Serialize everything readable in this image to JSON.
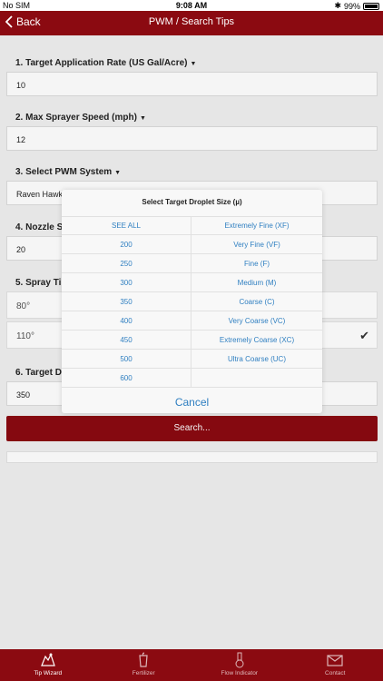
{
  "status_bar": {
    "carrier": "No SIM",
    "time": "9:08 AM",
    "battery": "99%",
    "battery_level": 0.99
  },
  "navbar": {
    "back_label": "Back",
    "title": "PWM / Search Tips"
  },
  "sections": [
    {
      "header": "1. Target Application Rate (US Gal/Acre)",
      "value": "10"
    },
    {
      "header": "2. Max Sprayer Speed (mph)",
      "value": "12"
    },
    {
      "header": "3. Select PWM System",
      "value": "Raven Hawke"
    },
    {
      "header": "4. Nozzle S",
      "value": "20"
    },
    {
      "header": "5. Spray Tip"
    },
    {
      "header": "6. Target Dr",
      "value": "350"
    }
  ],
  "spray_tip_options": [
    {
      "label": "80°",
      "selected": false
    },
    {
      "label": "110°",
      "selected": true
    }
  ],
  "search_button": "Search...",
  "modal": {
    "title": "Select Target Droplet Size (µ)",
    "left_options": [
      "SEE ALL",
      "200",
      "250",
      "300",
      "350",
      "400",
      "450",
      "500",
      "600"
    ],
    "right_options": [
      "Extremely Fine (XF)",
      "Very Fine (VF)",
      "Fine (F)",
      "Medium (M)",
      "Coarse (C)",
      "Very Coarse (VC)",
      "Extremely Coarse (XC)",
      "Ultra Coarse (UC)",
      ""
    ],
    "cancel": "Cancel"
  },
  "tabs": [
    {
      "label": "Tip Wizard",
      "icon": "tip-wizard-icon",
      "active": true
    },
    {
      "label": "Fertilizer",
      "icon": "fertilizer-icon",
      "active": false
    },
    {
      "label": "Flow Indicator",
      "icon": "flow-indicator-icon",
      "active": false
    },
    {
      "label": "Contact",
      "icon": "envelope-icon",
      "active": false
    }
  ],
  "colors": {
    "brand": "#8b0a11",
    "link": "#2f7fc1",
    "background": "#f0f0f0"
  }
}
